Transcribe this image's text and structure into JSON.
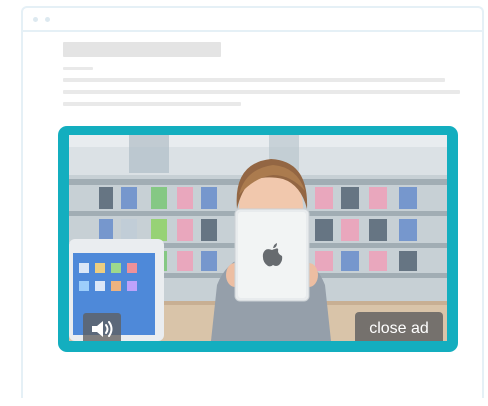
{
  "browser": {
    "window_buttons": [
      "window-dot",
      "window-dot"
    ]
  },
  "page_placeholder": {
    "title_lines": 1,
    "text_lines": 4
  },
  "ad": {
    "close_label": "close ad",
    "sound_icon": "speaker-icon",
    "frame_color": "#13aebf",
    "video_scene": "child-holding-tablet"
  }
}
